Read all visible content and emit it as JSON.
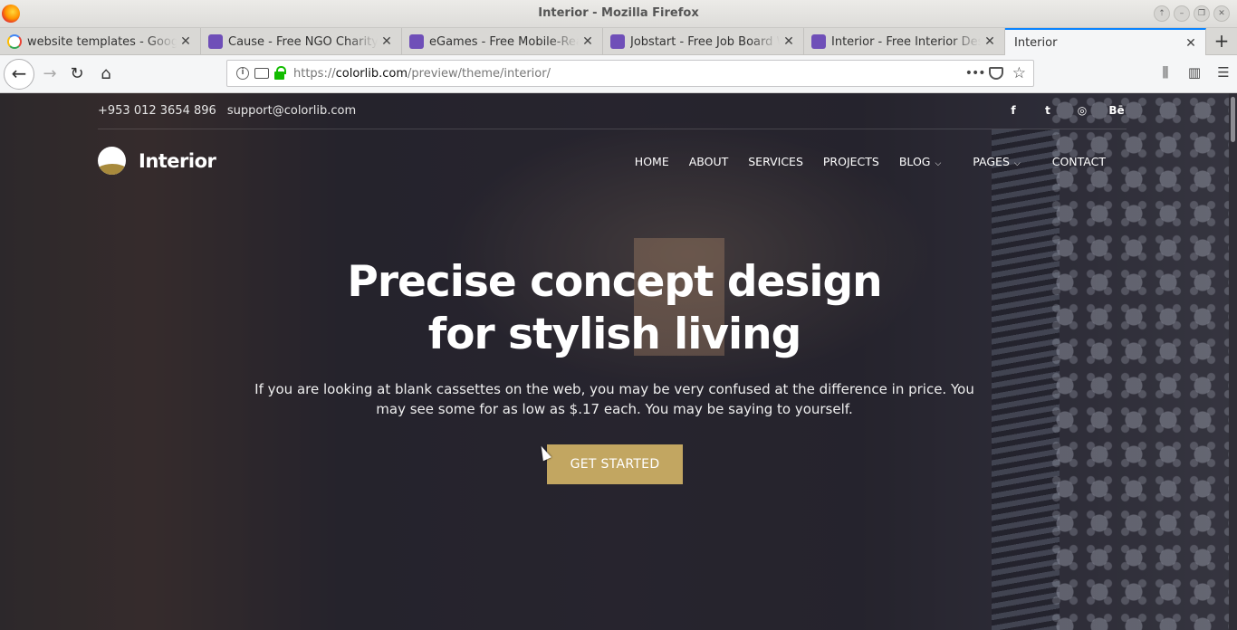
{
  "window": {
    "title": "Interior - Mozilla Firefox",
    "wm_buttons": [
      "⇡",
      "–",
      "❐",
      "✕"
    ]
  },
  "tabs": [
    {
      "label": "website templates - Google Search",
      "favicon": "google-icon",
      "close": "✕"
    },
    {
      "label": "Cause - Free NGO Charity Website Template",
      "favicon": "colorlib-icon",
      "close": "✕"
    },
    {
      "label": "eGames - Free Mobile-Ready Game Template",
      "favicon": "colorlib-icon",
      "close": "✕"
    },
    {
      "label": "Jobstart - Free Job Board Website Template",
      "favicon": "colorlib-icon",
      "close": "✕"
    },
    {
      "label": "Interior - Free Interior Design Template",
      "favicon": "colorlib-icon",
      "close": "✕"
    },
    {
      "label": "Interior",
      "favicon": "",
      "close": "✕",
      "active": true
    }
  ],
  "new_tab": "+",
  "navbar": {
    "back": "←",
    "forward": "→",
    "reload": "↻",
    "home": "⌂",
    "url_prefix": "https://",
    "url_host": "colorlib.com",
    "url_path": "/preview/theme/interior/",
    "page_actions": "•••",
    "bookmark_star": "☆",
    "right_icons": [
      "library-icon",
      "sidebar-icon",
      "menu-icon"
    ]
  },
  "site": {
    "phone": "+953 012 3654 896",
    "email": "support@colorlib.com",
    "social": [
      "f",
      "t",
      "◎",
      "Bē"
    ],
    "logo_text": "Interior",
    "nav": [
      {
        "label": "HOME",
        "dropdown": false
      },
      {
        "label": "ABOUT",
        "dropdown": false
      },
      {
        "label": "SERVICES",
        "dropdown": false
      },
      {
        "label": "PROJECTS",
        "dropdown": false
      },
      {
        "label": "BLOG",
        "dropdown": true
      },
      {
        "label": "PAGES",
        "dropdown": true
      },
      {
        "label": "CONTACT",
        "dropdown": false
      }
    ],
    "hero": {
      "title_line1": "Precise concept design",
      "title_line2": "for stylish living",
      "text": "If you are looking at blank cassettes on the web, you may be very confused at the difference in price. You may see some for as low as $.17 each. You may be saying to yourself.",
      "cta": "GET STARTED"
    }
  },
  "colors": {
    "accent": "#c2a661",
    "tab_active_border": "#0a84ff",
    "lock_green": "#12bc00"
  }
}
